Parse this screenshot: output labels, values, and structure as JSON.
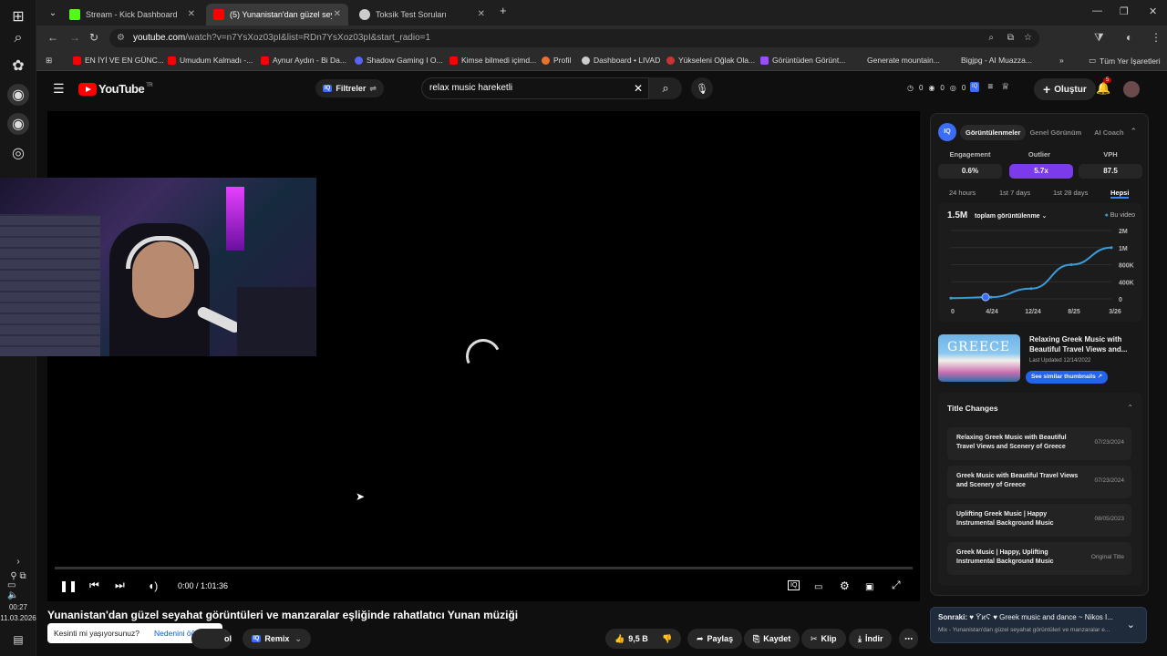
{
  "taskbar": {
    "time": "00:27",
    "date": "11.03.2026"
  },
  "tabs": [
    {
      "title": "Stream - Kick Dashboard",
      "color": "#53fc18"
    },
    {
      "title": "(5) Yunanistan'dan güzel seyaha",
      "color": "#ff0000"
    },
    {
      "title": "Toksik Test Soruları",
      "color": "#cccccc"
    }
  ],
  "address": {
    "url_host": "youtube.com",
    "url_rest": "/watch?v=n7YsXoz03pI&list=RDn7YsXoz03pI&start_radio=1"
  },
  "bookmarks": [
    {
      "label": "EN İYİ VE EN GÜNC...",
      "color": "#ff0000"
    },
    {
      "label": "Umudum Kalmadı -...",
      "color": "#ff0000"
    },
    {
      "label": "Aynur Aydın - Bi Da...",
      "color": "#ff0000"
    },
    {
      "label": "Shadow Gaming I O...",
      "color": "#5865f2"
    },
    {
      "label": "Kimse bilmedi içimd...",
      "color": "#ff0000"
    },
    {
      "label": "Profil",
      "color": "#e6732e"
    },
    {
      "label": "Dashboard • LIVAD",
      "color": "#cccccc"
    },
    {
      "label": "Yükseleni Oğlak Ola...",
      "color": "#cc3333"
    },
    {
      "label": "Görüntüden Görünt...",
      "color": "#9b4dff"
    },
    {
      "label": "Generate mountain...",
      "color": "#2b2b2b"
    },
    {
      "label": "Bigjpg - AI Muazza...",
      "color": "#2b2b2b"
    }
  ],
  "bookmarks_more": "Tüm Yer İşaretleri",
  "yt": {
    "logo": "YouTube",
    "region": "TR",
    "filters": "Filtreler",
    "search_value": "relax music hareketli",
    "counters": [
      "0",
      "0",
      "0"
    ],
    "create": "Oluştur",
    "notif_count": "5"
  },
  "player": {
    "time": "0:00 / 1:01:36"
  },
  "video": {
    "title": "Yunanistan'dan güzel seyahat görüntüleri ve manzaralar eşliğinde rahatlatıcı Yunan müziği",
    "likes": "9,5 B",
    "share": "Paylaş",
    "save": "Kaydet",
    "clip": "Klip",
    "download": "İndir",
    "remix": "Remix",
    "partial": "ol"
  },
  "toast": {
    "question": "Kesinti mi yaşıyorsunuz?",
    "link": "Nedenini öğrenin"
  },
  "side": {
    "badge": "IQ",
    "tabs": [
      "Görüntülenmeler",
      "Genel Görünüm",
      "AI Coach"
    ],
    "metrics": [
      {
        "label": "Engagement",
        "value": "0.6%"
      },
      {
        "label": "Outlier",
        "value": "5.7x"
      },
      {
        "label": "VPH",
        "value": "87.5"
      }
    ],
    "ranges": [
      "24 hours",
      "1st 7 days",
      "1st 28 days",
      "Hepsi"
    ],
    "chart": {
      "big": "1.5M",
      "mode": "toplam görüntülenme",
      "legend": "Bu video"
    },
    "thumb_text": "GREECE",
    "thumb_title": "Relaxing Greek Music with Beautiful Travel Views and...",
    "last_updated": "Last Updated 12/14/2022",
    "similar": "See similar thumbnails",
    "tc_title": "Title Changes",
    "title_changes": [
      {
        "title": "Relaxing Greek Music with Beautiful Travel Views and Scenery of Greece",
        "date": "07/23/2024"
      },
      {
        "title": "Greek Music with Beautiful Travel Views and Scenery of Greece",
        "date": "07/23/2024"
      },
      {
        "title": "Uplifting Greek Music | Happy Instrumental Background Music",
        "date": "08/05/2023"
      },
      {
        "title": "Greek Music | Happy, Uplifting Instrumental Background Music",
        "date": "Original Title"
      }
    ]
  },
  "chart_data": {
    "type": "line",
    "x": [
      "0",
      "4/24",
      "12/24",
      "8/25",
      "3/26"
    ],
    "values": [
      0.02,
      0.05,
      0.3,
      1.0,
      1.5
    ],
    "yticks": [
      "2M",
      "1M",
      "800K",
      "400K",
      "0"
    ],
    "series": [
      {
        "name": "Bu video",
        "values": [
          0.02,
          0.05,
          0.3,
          1.0,
          1.5
        ]
      }
    ]
  },
  "next": {
    "label": "Sonraki:",
    "title": "♥ ϔϰϚ ♥ Greek music and dance ~ Nikos I...",
    "subtitle": "Mix - Yunanistan'dan güzel seyahat görüntüleri ve manzaralar e..."
  }
}
